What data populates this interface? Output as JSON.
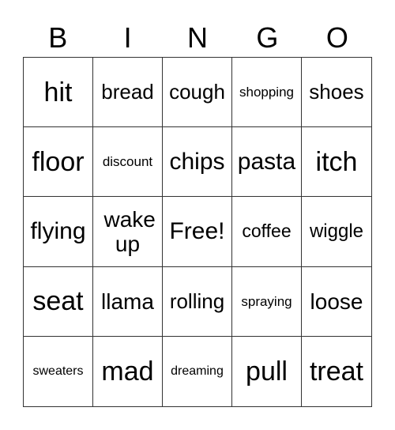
{
  "header": [
    "B",
    "I",
    "N",
    "G",
    "O"
  ],
  "cells": [
    "hit",
    "bread",
    "cough",
    "shopping",
    "shoes",
    "floor",
    "discount",
    "chips",
    "pasta",
    "itch",
    "flying",
    "wake up",
    "Free!",
    "coffee",
    "wiggle",
    "seat",
    "llama",
    "rolling",
    "spraying",
    "loose",
    "sweaters",
    "mad",
    "dreaming",
    "pull",
    "treat"
  ]
}
